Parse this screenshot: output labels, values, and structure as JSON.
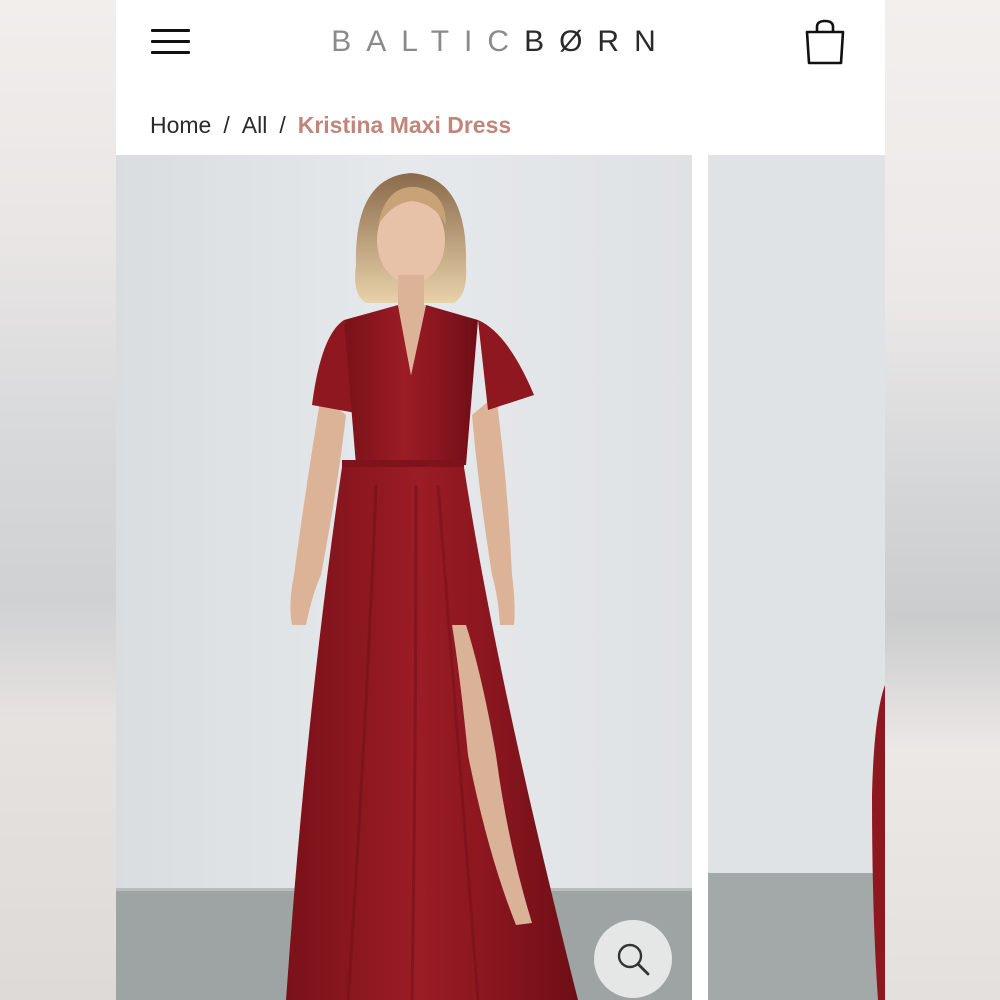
{
  "header": {
    "logo_part1": "BALTIC",
    "logo_part2": "BØRN",
    "menu_icon": "hamburger-menu-icon",
    "cart_icon": "shopping-bag-icon"
  },
  "breadcrumb": {
    "items": [
      "Home",
      "All"
    ],
    "separator": "/",
    "current": "Kristina Maxi Dress"
  },
  "gallery": {
    "zoom_icon": "magnifier-icon"
  },
  "colors": {
    "accent": "#c0867a",
    "dress": "#8e1720",
    "text": "#2b2b2b"
  }
}
